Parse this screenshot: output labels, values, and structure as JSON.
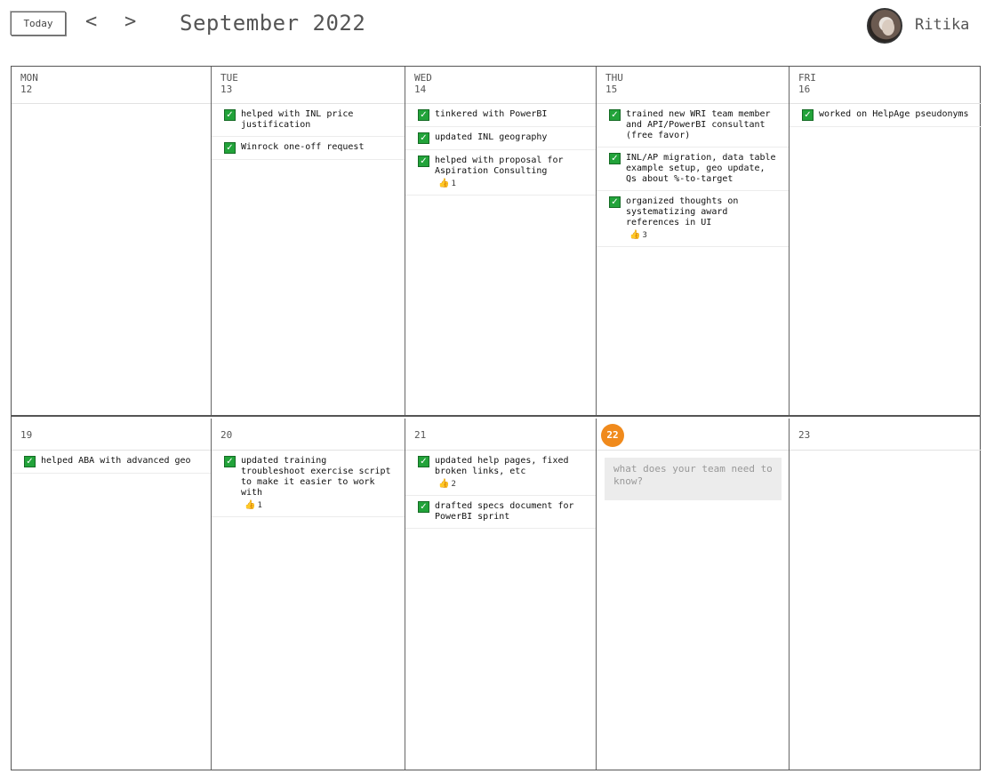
{
  "header": {
    "today_label": "Today",
    "prev_label": "<",
    "next_label": ">",
    "month_title": "September 2022",
    "user_name": "Ritika"
  },
  "colors": {
    "today_badge": "#f08a1c",
    "check": "#22a33a",
    "input_bg": "#ececec"
  },
  "weeks": [
    {
      "days": [
        {
          "name": "MON",
          "num": "12",
          "entries": []
        },
        {
          "name": "TUE",
          "num": "13",
          "entries": [
            {
              "text": "helped with INL price justification",
              "likes": null
            },
            {
              "text": "Winrock one-off request",
              "likes": null
            }
          ]
        },
        {
          "name": "WED",
          "num": "14",
          "entries": [
            {
              "text": "tinkered with PowerBI",
              "likes": null
            },
            {
              "text": "updated INL geography",
              "likes": null
            },
            {
              "text": "helped with proposal for Aspiration Consulting",
              "likes": "1"
            }
          ]
        },
        {
          "name": "THU",
          "num": "15",
          "entries": [
            {
              "text": "trained new WRI team member and API/PowerBI consultant (free favor)",
              "likes": null
            },
            {
              "text": "INL/AP migration, data table example setup, geo update, Qs about %-to-target",
              "likes": null
            },
            {
              "text": "organized thoughts on systematizing award references in UI",
              "likes": "3"
            }
          ]
        },
        {
          "name": "FRI",
          "num": "16",
          "entries": [
            {
              "text": "worked on HelpAge pseudonyms",
              "likes": null
            }
          ]
        }
      ]
    },
    {
      "days": [
        {
          "num": "19",
          "entries": [
            {
              "text": "helped ABA with advanced geo",
              "likes": null
            }
          ]
        },
        {
          "num": "20",
          "entries": [
            {
              "text": "updated training troubleshoot exercise script to make it easier to work with",
              "likes": "1"
            }
          ]
        },
        {
          "num": "21",
          "entries": [
            {
              "text": "updated help pages, fixed broken links, etc",
              "likes": "2"
            },
            {
              "text": "drafted specs document for PowerBI sprint",
              "likes": null
            }
          ]
        },
        {
          "num": "22",
          "today": true,
          "input_placeholder": "what does your team need to know?"
        },
        {
          "num": "23",
          "entries": []
        }
      ]
    }
  ],
  "icons": {
    "check": "check-icon",
    "thumb": "thumbs-up-icon",
    "avatar": "user-avatar"
  }
}
